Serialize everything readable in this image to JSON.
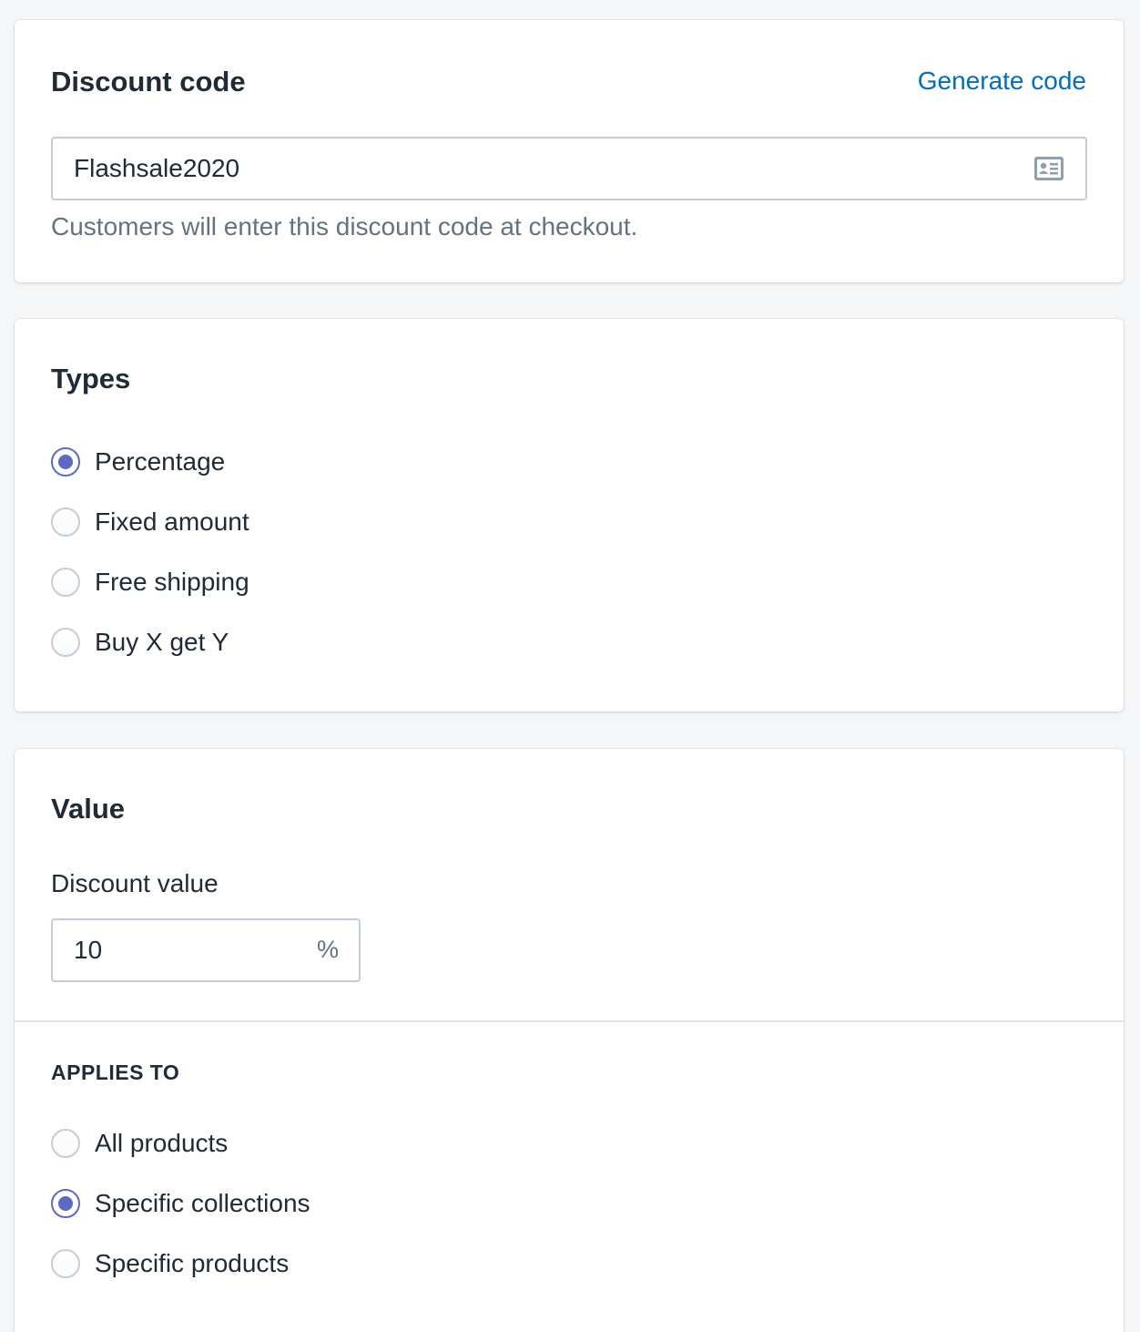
{
  "discount_code": {
    "title": "Discount code",
    "generate_label": "Generate code",
    "value": "Flashsale2020",
    "icon": "contact-card-icon",
    "help": "Customers will enter this discount code at checkout."
  },
  "types": {
    "title": "Types",
    "options": [
      {
        "label": "Percentage",
        "checked": true
      },
      {
        "label": "Fixed amount",
        "checked": false
      },
      {
        "label": "Free shipping",
        "checked": false
      },
      {
        "label": "Buy X get Y",
        "checked": false
      }
    ]
  },
  "value_section": {
    "title": "Value",
    "field_label": "Discount value",
    "field_value": "10",
    "suffix": "%",
    "applies_to_heading": "APPLIES TO",
    "applies_to_options": [
      {
        "label": "All products",
        "checked": false
      },
      {
        "label": "Specific collections",
        "checked": true
      },
      {
        "label": "Specific products",
        "checked": false
      }
    ]
  },
  "colors": {
    "accent": "#5c6ac4",
    "link": "#006fbb",
    "subdued_text": "#637381",
    "background": "#f4f6f8"
  }
}
